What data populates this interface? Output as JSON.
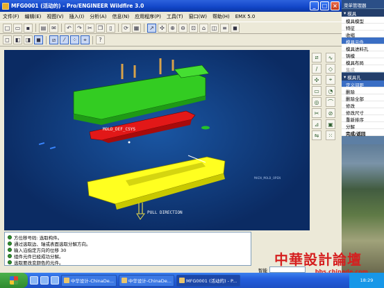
{
  "window": {
    "title": "MFG0001 (活动的) - Pro/ENGINEER Wildfire 3.0",
    "minimize": "_",
    "maximize": "□",
    "close": "×"
  },
  "menubar": [
    "文件(F)",
    "编辑(E)",
    "视图(V)",
    "插入(I)",
    "分析(A)",
    "信息(N)",
    "应用程序(P)",
    "工具(T)",
    "窗口(W)",
    "帮助(H)",
    "EMX 5.0"
  ],
  "toolbar_icons": [
    "new",
    "open",
    "save",
    "print",
    "email",
    "cut",
    "copy",
    "paste",
    "undo",
    "redo",
    "regen",
    "zoom-in",
    "zoom-out",
    "refit",
    "repaint",
    "shade",
    "hidden",
    "wireframe",
    "datum-planes",
    "datum-axes",
    "points",
    "csys"
  ],
  "viewport": {
    "csys_label": "MOLD_DEF_CSYS",
    "pull_direction_label": "PULL DIRECTION",
    "ref_label": "MAIN_MOLD_OPEN"
  },
  "messages": [
    "方位移号码: 选取构件。",
    "通过选取边、轴或表面选取分解方向。",
    "输入沿指定方向的位移  30",
    "组件元件已经成功分解。",
    "选取要改变颜色的元件。"
  ],
  "smart_label": "智能",
  "menu_manager": {
    "title": "菜单管理器",
    "mold_section": "模具",
    "mold_items": [
      "模具模型",
      "特征",
      "收缩",
      "模具元件",
      "模具进料孔",
      "铸模",
      "模具布局",
      "集成"
    ],
    "mold_selected_index": 3,
    "mold_disabled_index": 7,
    "mold_hole_section": "模具孔",
    "hole_items": [
      "定义间距",
      "删除",
      "删除全部",
      "修改",
      "修改尺寸",
      "重新排序",
      "分解",
      "完成/返回"
    ],
    "hole_selected_index": 0
  },
  "taskbar": {
    "tasks": [
      "中华设计-ChinaDe...",
      "中华设计-ChinaDe...",
      "MFG0001 (活动的) - P..."
    ],
    "clock": "18:29"
  },
  "watermark": {
    "title": "中華設計論壇",
    "url": "bbs.chinade.com"
  }
}
